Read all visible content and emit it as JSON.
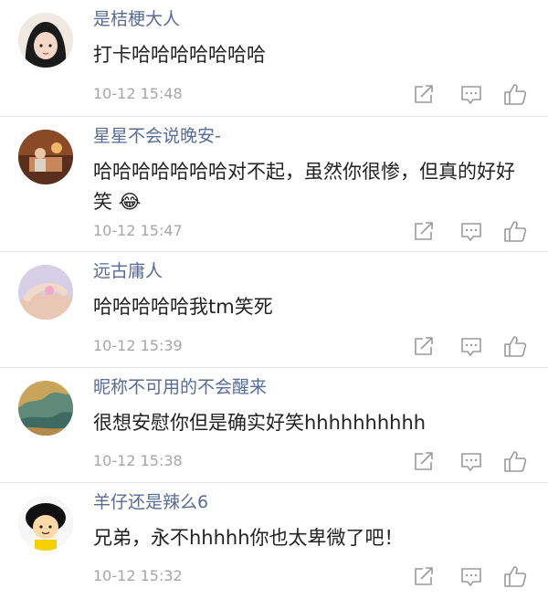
{
  "comments": [
    {
      "user": "是桔梗大人",
      "text": "打卡哈哈哈哈哈哈哈",
      "emoji": "",
      "time": "10-12 15:48",
      "avatar_icon": "black-hair-girl-avatar"
    },
    {
      "user": "星星不会说晚安-",
      "text": "哈哈哈哈哈哈哈对不起，虽然你很惨，但真的好好笑",
      "emoji": "😂",
      "time": "10-12 15:47",
      "avatar_icon": "warm-room-avatar"
    },
    {
      "user": "远古庸人",
      "text": "哈哈哈哈哈我tm笑死",
      "emoji": "",
      "time": "10-12 15:39",
      "avatar_icon": "hand-avatar"
    },
    {
      "user": "昵称不可用的不会醒来",
      "text": "很想安慰你但是确实好笑hhhhhhhhhh",
      "emoji": "",
      "time": "10-12 15:38",
      "avatar_icon": "painting-avatar"
    },
    {
      "user": "羊仔还是辣么6",
      "text": "兄弟，永不hhhhh你也太卑微了吧！",
      "emoji": "",
      "time": "10-12 15:32",
      "avatar_icon": "cartoon-avatar"
    }
  ],
  "colors": {
    "username": "#576b95",
    "text": "#222222",
    "time": "#a6a6a6",
    "icon": "#9a9a9a"
  }
}
